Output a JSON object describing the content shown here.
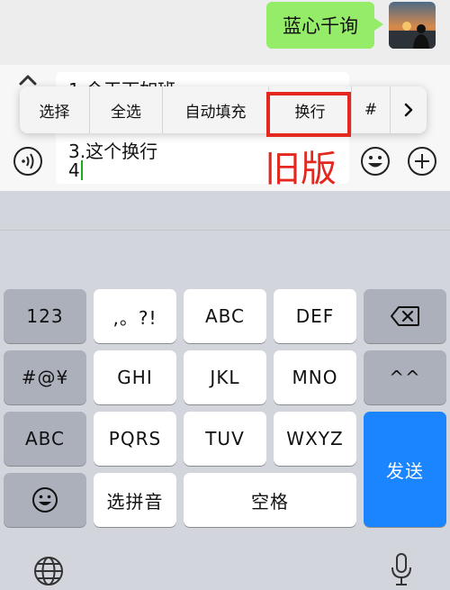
{
  "chat": {
    "message": "蓝心千询"
  },
  "composer": {
    "lines": [
      "1.今天下如班",
      "3.这个换行",
      "4"
    ]
  },
  "edit_menu": {
    "items": [
      "选择",
      "全选",
      "自动填充",
      "换行",
      "#"
    ],
    "highlighted_item": "换行"
  },
  "annotation": {
    "text": "旧版",
    "color": "#e4281f"
  },
  "keyboard": {
    "row1": [
      "123",
      ",。?!",
      "ABC",
      "DEF"
    ],
    "row2": [
      "#@¥",
      "GHI",
      "JKL",
      "MNO",
      "^^"
    ],
    "row3": [
      "ABC",
      "PQRS",
      "TUV",
      "WXYZ"
    ],
    "row4": [
      "选拼音",
      "空格"
    ],
    "send_label": "发送",
    "send_color": "#1a85ff"
  },
  "icons": [
    "chevron-up-icon",
    "voice-icon",
    "emoji-icon",
    "plus-icon",
    "chevron-right-icon",
    "backspace-icon",
    "globe-icon",
    "microphone-icon"
  ]
}
